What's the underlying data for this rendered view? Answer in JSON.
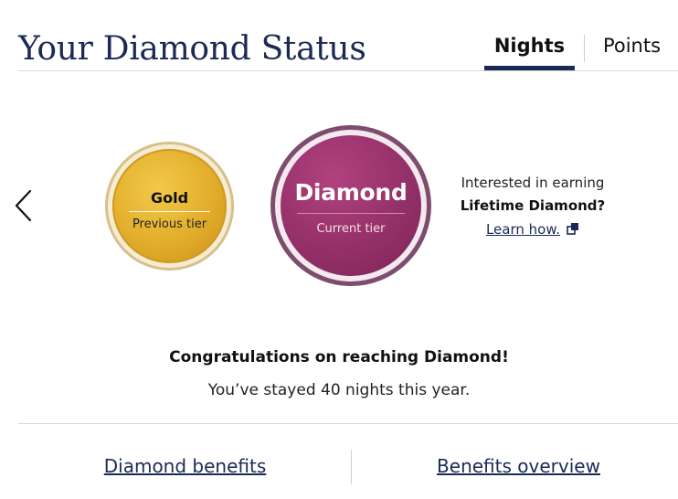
{
  "header": {
    "title": "Your Diamond Status",
    "tabs": [
      {
        "label": "Nights",
        "selected": true
      },
      {
        "label": "Points",
        "selected": false
      }
    ]
  },
  "carousel": {
    "prev_icon": "chevron-left-icon"
  },
  "tiers": {
    "previous": {
      "name": "Gold",
      "caption": "Previous tier",
      "color": "#E2AD2A"
    },
    "current": {
      "name": "Diamond",
      "caption": "Current tier",
      "color": "#9A336D"
    }
  },
  "promo": {
    "line1": "Interested in earning",
    "line2": "Lifetime Diamond?",
    "link_label": "Learn how.",
    "link_icon": "external-link-icon"
  },
  "message": {
    "title": "Congratulations on reaching Diamond!",
    "subtitle": "You’ve stayed 40 nights this year."
  },
  "footer": {
    "links": [
      {
        "label": "Diamond benefits"
      },
      {
        "label": "Benefits overview"
      }
    ]
  },
  "colors": {
    "navy": "#1B2A55",
    "gold": "#E2AD2A",
    "diamond": "#9A336D"
  }
}
